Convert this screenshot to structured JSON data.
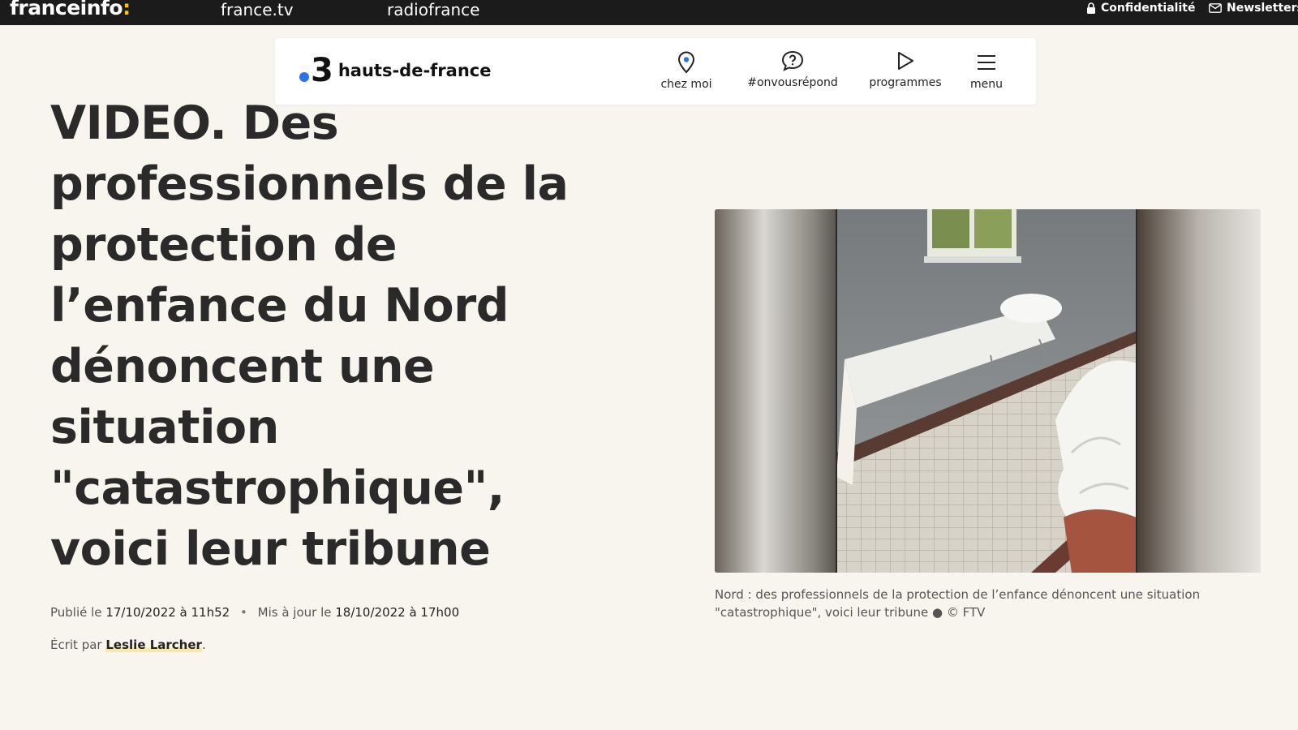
{
  "topbar": {
    "brand": "franceinfo",
    "brand_colon": ":",
    "links": [
      "france.tv",
      "radiofrance"
    ],
    "privacy": "Confidentialité",
    "newsletters": "Newsletters"
  },
  "header": {
    "channel_number": "3",
    "region": "hauts-de-france",
    "nav": [
      {
        "label": "chez moi",
        "icon": "location-pin-icon"
      },
      {
        "label": "#onvousrépond",
        "icon": "question-bubble-icon"
      },
      {
        "label": "programmes",
        "icon": "play-icon"
      },
      {
        "label": "menu",
        "icon": "hamburger-menu-icon"
      }
    ]
  },
  "article": {
    "title": "VIDEO. Des professionnels de la protection de l’enfance du Nord dénoncent une situation \"catastrophique\", voici leur tribune",
    "published_prefix": "Publié le",
    "published": "17/10/2022 à 11h52",
    "separator": "•",
    "updated_prefix": "Mis à jour le",
    "updated": "18/10/2022 à 17h00",
    "byline_prefix": "Écrit par",
    "author": "Leslie Larcher",
    "byline_suffix": ".",
    "caption": "Nord : des professionnels de la protection de l’enfance dénoncent une situation \"catastrophique\", voici leur tribune ● © FTV"
  },
  "colors": {
    "background": "#f8f5ef",
    "topbar": "#1b1b1b",
    "brand_accent": "#fec109",
    "logo_dot": "#2d73e6"
  }
}
